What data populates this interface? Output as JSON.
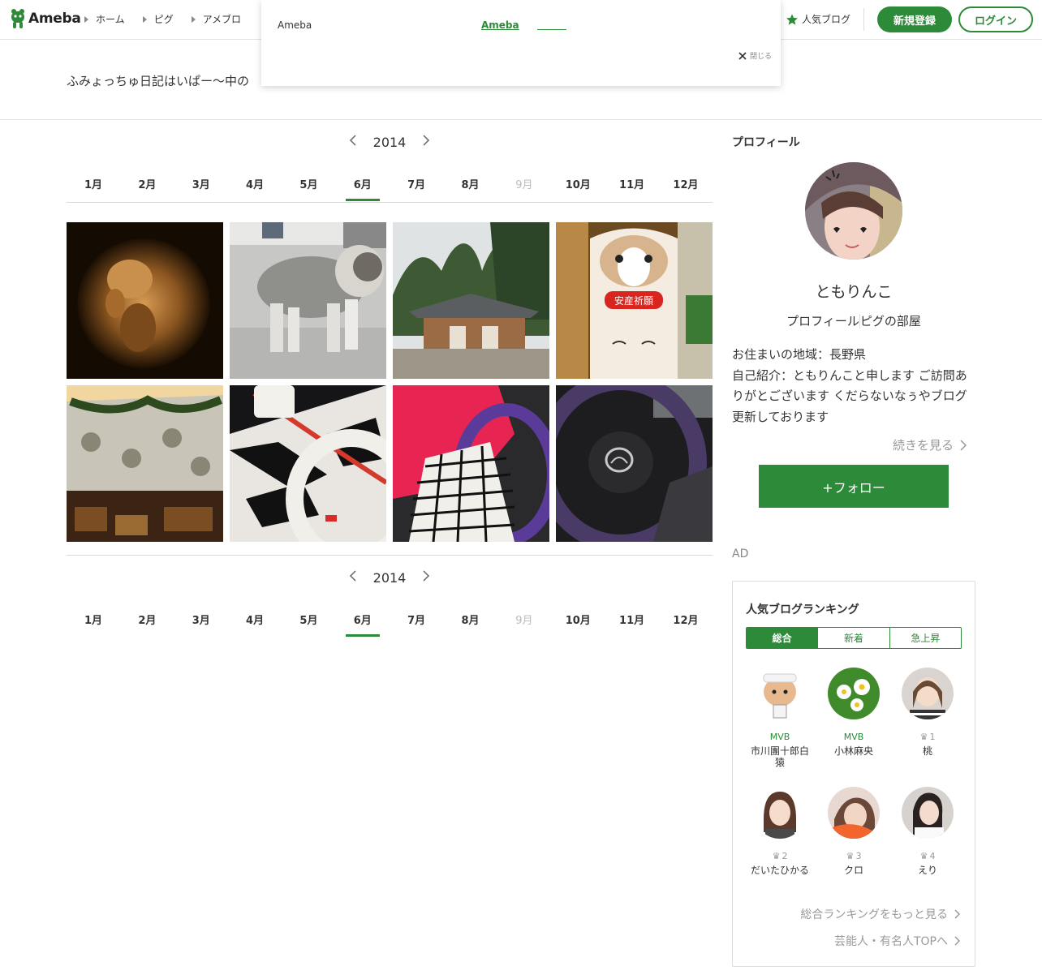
{
  "header": {
    "logo": "Ameba",
    "nav": [
      "ホーム",
      "ピグ",
      "アメブロ"
    ],
    "popular_blog": "人気ブログ",
    "register": "新規登録",
    "login": "ログイン",
    "accent": "#2d8a39"
  },
  "popup": {
    "text": "Ameba",
    "link": "Ameba",
    "close": "閉じる"
  },
  "blog": {
    "title": "ふみょっちゅ日記はいぱー〜中の"
  },
  "archive": {
    "year": "2014",
    "months": [
      "1月",
      "2月",
      "3月",
      "4月",
      "5月",
      "6月",
      "7月",
      "8月",
      "9月",
      "10月",
      "11月",
      "12月"
    ],
    "active_month": "6月",
    "disabled_month": "9月",
    "images": [
      "ultrasound",
      "cat",
      "shrine",
      "ema",
      "curtain",
      "zebra-seat",
      "steering-purple",
      "steering-mazda"
    ]
  },
  "profile": {
    "heading": "プロフィール",
    "nickname": "ともりんこ",
    "link_profile": "プロフィール",
    "link_room": "ピグの部屋",
    "text_1": "お住まいの地域：長野県",
    "text_2": "自己紹介：ともりんこと申します ご訪問ありがとございます くだらないなぅやブログ更新しております",
    "more": "続きを見る",
    "follow": "+フォロー"
  },
  "ad": "AD",
  "ranking": {
    "title": "人気ブログランキング",
    "tabs": [
      "総合",
      "新着",
      "急上昇"
    ],
    "items": [
      {
        "badge": "MVB",
        "name": "市川團十郎白猿"
      },
      {
        "badge": "MVB",
        "name": "小林麻央"
      },
      {
        "badge": "1",
        "name": "桃"
      },
      {
        "badge": "2",
        "name": "だいたひかる"
      },
      {
        "badge": "3",
        "name": "クロ"
      },
      {
        "badge": "4",
        "name": "えり"
      }
    ],
    "more_total": "総合ランキングをもっと見る",
    "more_celeb": "芸能人・有名人TOPへ"
  }
}
